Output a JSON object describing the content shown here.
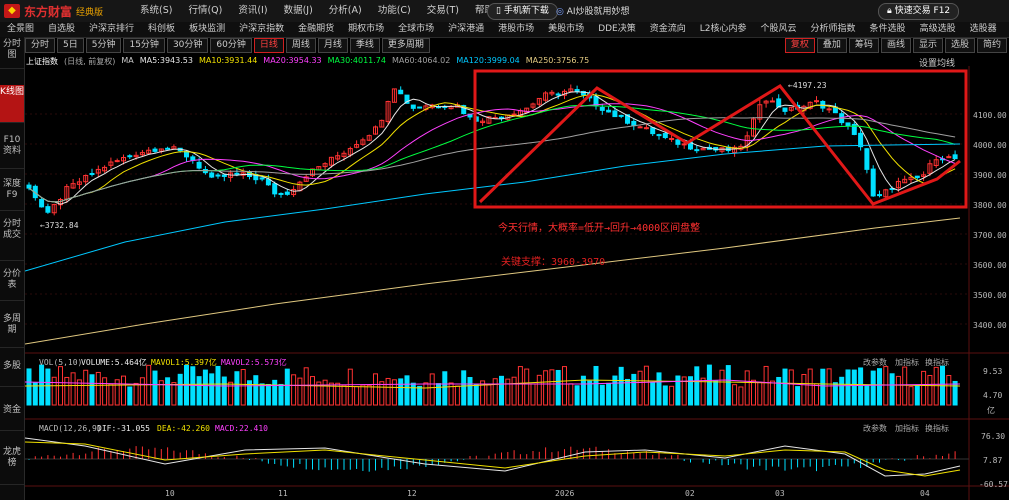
{
  "app": {
    "logo_text": "东方财富",
    "edition": "经典版",
    "menu": [
      "系统(S)",
      "行情(Q)",
      "资讯(I)",
      "数据(J)",
      "分析(A)",
      "功能(C)",
      "交易(T)",
      "帮助(H)"
    ],
    "mobile_btn": "手机新下载",
    "ai_btn": "AI炒股就用妙想",
    "quick_trade": "快速交易 F12"
  },
  "nav": [
    "全景图",
    "自选股",
    "沪深京排行",
    "科创板",
    "板块监测",
    "沪深京指数",
    "金融期货",
    "期权市场",
    "全球市场",
    "沪深港通",
    "港股市场",
    "美股市场",
    "DDE决策",
    "资金流向",
    "L2核心内参",
    "个股风云",
    "分析师指数",
    "条件选股",
    "高级选股",
    "选股器",
    "机"
  ],
  "sidebar": [
    "分时图",
    "K线图",
    "F10资料",
    "深度F9",
    "分时成交",
    "分价表",
    "多周期",
    "多股",
    "资金",
    "龙虎榜"
  ],
  "periods": [
    "分时",
    "5日",
    "5分钟",
    "15分钟",
    "30分钟",
    "60分钟",
    "日线",
    "周线",
    "月线",
    "季线",
    "更多周期"
  ],
  "active_period": "日线",
  "toolbar_right": [
    "复权",
    "叠加",
    "筹码",
    "画线",
    "显示",
    "选股",
    "简约"
  ],
  "chart_header": {
    "name": "上证指数",
    "subtitle": "(日线, 前复权)",
    "ma_label": "MA",
    "ma": [
      {
        "label": "MA5:3943.53",
        "color": "#e6e6e6"
      },
      {
        "label": "MA10:3931.44",
        "color": "#f0e000"
      },
      {
        "label": "MA20:3954.33",
        "color": "#ff40ff"
      },
      {
        "label": "MA30:4011.74",
        "color": "#00ff40"
      },
      {
        "label": "MA60:4064.02",
        "color": "#a0a0a0"
      },
      {
        "label": "MA120:3999.04",
        "color": "#00c8ff"
      },
      {
        "label": "MA250:3756.75",
        "color": "#e0c880"
      }
    ],
    "settings": "设置均线"
  },
  "price_axis": [
    "4100.00",
    "4000.00",
    "3900.00",
    "3800.00",
    "3700.00",
    "3600.00",
    "3500.00",
    "3400.00"
  ],
  "annotations": {
    "high_label": "4197.23",
    "low_label": "3732.84",
    "note1": "今天行情，大概率=低开→回升→4000区间盘整",
    "note2": "关键支撑：3960-3970"
  },
  "volume_header": {
    "name": "VOL(5,10)",
    "vol": "VOLUME:5.464亿",
    "ma1": "MAVOL1:5.397亿",
    "ma2": "MAVOL2:5.573亿",
    "buttons": [
      "改参数",
      "加指标",
      "换指标"
    ],
    "axis": [
      "9.53",
      "4.70",
      "亿"
    ]
  },
  "macd_header": {
    "name": "MACD(12,26,9)",
    "dif": "DIF:-31.055",
    "dea": "DEA:-42.260",
    "macd": "MACD:22.410",
    "buttons": [
      "改参数",
      "加指标",
      "换指标"
    ],
    "axis": [
      "76.30",
      "7.87",
      "-60.57"
    ]
  },
  "date_axis": [
    "10",
    "11",
    "12",
    "2026",
    "02",
    "03",
    "04"
  ],
  "colors": {
    "up": "#ff3232",
    "down": "#00e0ff",
    "accent": "#d02020"
  }
}
